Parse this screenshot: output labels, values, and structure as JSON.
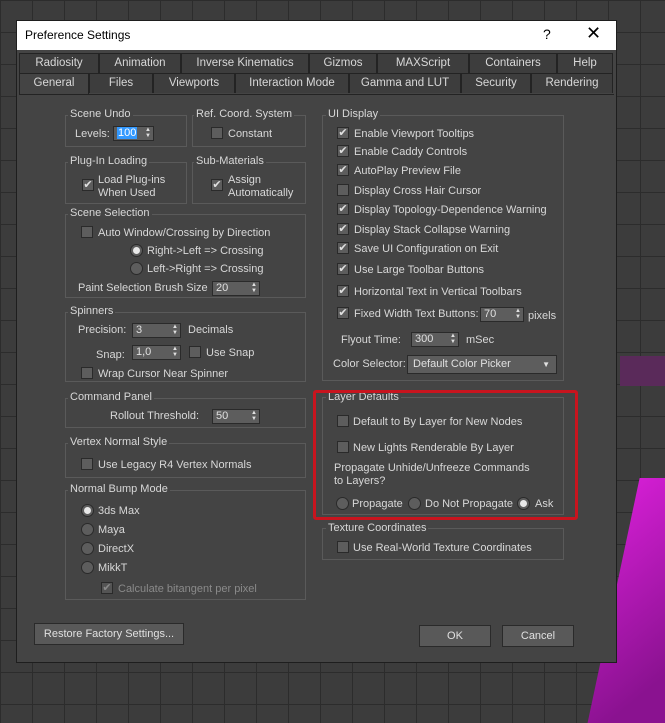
{
  "window": {
    "title": "Preference Settings",
    "help_label": "?",
    "close_label": "✕"
  },
  "tabs_row1": [
    "Radiosity",
    "Animation",
    "Inverse Kinematics",
    "Gizmos",
    "MAXScript",
    "Containers",
    "Help"
  ],
  "tabs_row2": [
    "General",
    "Files",
    "Viewports",
    "Interaction Mode",
    "Gamma and LUT",
    "Security",
    "Rendering"
  ],
  "active_tab": "General",
  "scene_undo": {
    "title": "Scene Undo",
    "levels_label": "Levels:",
    "levels_value": "100"
  },
  "ref_coord": {
    "title": "Ref. Coord. System",
    "constant_label": "Constant",
    "constant_checked": false
  },
  "plugin_loading": {
    "title": "Plug-In Loading",
    "load_label_1": "Load Plug-ins",
    "load_label_2": "When Used",
    "load_checked": true
  },
  "sub_materials": {
    "title": "Sub-Materials",
    "assign_label_1": "Assign",
    "assign_label_2": "Automatically",
    "assign_checked": true
  },
  "scene_selection": {
    "title": "Scene Selection",
    "auto_window_label": "Auto Window/Crossing by Direction",
    "auto_window_checked": false,
    "rtl_label": "Right->Left => Crossing",
    "ltr_label": "Left->Right => Crossing",
    "paint_brush_label": "Paint Selection Brush Size",
    "paint_brush_value": "20"
  },
  "spinners": {
    "title": "Spinners",
    "precision_label": "Precision:",
    "precision_value": "3",
    "decimals_label": "Decimals",
    "snap_label": "Snap:",
    "snap_value": "1,0",
    "use_snap_label": "Use Snap",
    "wrap_label": "Wrap Cursor Near Spinner"
  },
  "command_panel": {
    "title": "Command Panel",
    "rollout_label": "Rollout Threshold:",
    "rollout_value": "50"
  },
  "vertex_normal": {
    "title": "Vertex Normal Style",
    "legacy_label": "Use Legacy R4 Vertex Normals"
  },
  "normal_bump": {
    "title": "Normal Bump Mode",
    "options": [
      "3ds Max",
      "Maya",
      "DirectX",
      "MikkT"
    ],
    "selected": "3ds Max",
    "bitangent_label": "Calculate bitangent per pixel"
  },
  "ui_display": {
    "title": "UI Display",
    "items": [
      {
        "label": "Enable Viewport Tooltips",
        "checked": true
      },
      {
        "label": "Enable Caddy Controls",
        "checked": true
      },
      {
        "label": "AutoPlay Preview File",
        "checked": true
      },
      {
        "label": "Display Cross Hair Cursor",
        "checked": false
      },
      {
        "label": "Display Topology-Dependence Warning",
        "checked": true
      },
      {
        "label": "Display Stack Collapse Warning",
        "checked": true
      },
      {
        "label": "Save UI Configuration on Exit",
        "checked": true
      },
      {
        "label": "Use Large Toolbar Buttons",
        "checked": true
      },
      {
        "label": "Horizontal Text in Vertical Toolbars",
        "checked": true
      },
      {
        "label": "Fixed Width Text Buttons:",
        "checked": true
      }
    ],
    "fixed_width_value": "70",
    "pixels_label": "pixels",
    "flyout_label": "Flyout Time:",
    "flyout_value": "300",
    "msec_label": "mSec",
    "color_selector_label": "Color Selector:",
    "color_selector_value": "Default Color Picker"
  },
  "layer_defaults": {
    "title": "Layer Defaults",
    "default_bylayer_label": "Default to By Layer for New Nodes",
    "new_lights_label": "New Lights Renderable By Layer",
    "propagate_q_1": "Propagate Unhide/Unfreeze Commands",
    "propagate_q_2": "to Layers?",
    "propagate_options": [
      "Propagate",
      "Do Not Propagate",
      "Ask"
    ],
    "propagate_selected": "Ask"
  },
  "texture_coords": {
    "title": "Texture Coordinates",
    "real_world_label": "Use Real-World Texture Coordinates"
  },
  "buttons": {
    "restore": "Restore Factory Settings...",
    "ok": "OK",
    "cancel": "Cancel"
  },
  "check_glyph": "✔",
  "arrow_up": "▲",
  "arrow_down": "▼",
  "caret": "▼",
  "colors": {
    "highlight_border": "#c8141e",
    "selection_blue": "#3399ff"
  }
}
